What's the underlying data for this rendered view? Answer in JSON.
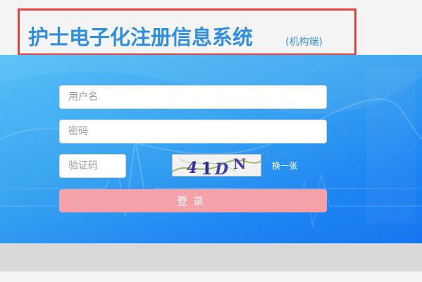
{
  "header": {
    "title": "护士电子化注册信息系统",
    "subtitle": "(机构端)"
  },
  "form": {
    "username_placeholder": "用户名",
    "password_placeholder": "密码",
    "captcha_placeholder": "验证码",
    "captcha_text": [
      "4",
      "1",
      "D",
      "N"
    ],
    "refresh_label": "换一张",
    "login_label": "登录"
  },
  "colors": {
    "title": "#2f8fdd",
    "frame": "#e0453f",
    "banner": "#2a95f2",
    "login_button": "#f5a1aa"
  }
}
